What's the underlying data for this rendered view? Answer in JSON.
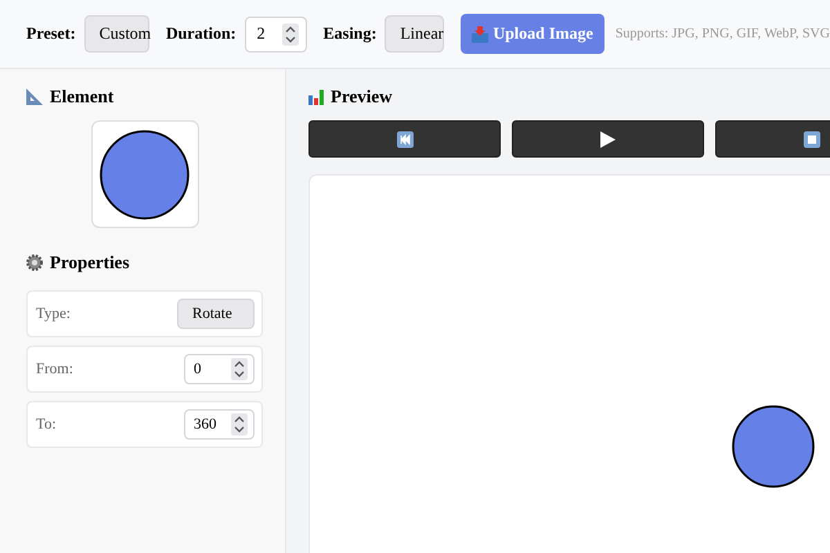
{
  "toolbar": {
    "preset": {
      "label": "Preset:",
      "value": "Custom"
    },
    "duration": {
      "label": "Duration:",
      "value": "2"
    },
    "easing": {
      "label": "Easing:",
      "value": "Linear"
    },
    "upload_button": "Upload Image",
    "supports_note": "Supports: JPG, PNG, GIF, WebP, SVG"
  },
  "element_panel": {
    "title": "Element"
  },
  "properties": {
    "title": "Properties",
    "rows": [
      {
        "kind": "select",
        "label": "Type:",
        "value": "Rotate"
      },
      {
        "kind": "number",
        "label": "From:",
        "value": "0"
      },
      {
        "kind": "number",
        "label": "To:",
        "value": "360"
      }
    ]
  },
  "preview": {
    "title": "Preview",
    "controls": [
      {
        "kind": "rewind"
      },
      {
        "kind": "play"
      },
      {
        "kind": "stop"
      }
    ]
  }
}
